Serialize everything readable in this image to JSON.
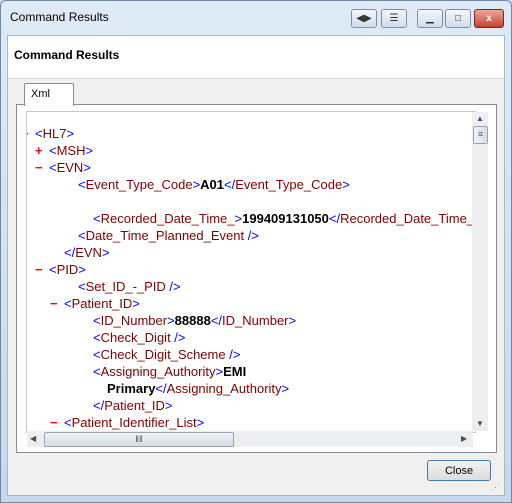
{
  "window": {
    "title": "Command Results",
    "close_glyph": "x"
  },
  "header": {
    "title": "Command Results"
  },
  "tabs": [
    {
      "label": "Xml"
    }
  ],
  "xml_lines": [
    {
      "toggle": "−",
      "parts": [
        {
          "k": "br",
          "t": "<"
        },
        {
          "k": "tg",
          "t": "HL7"
        },
        {
          "k": "br",
          "t": ">"
        }
      ]
    },
    {
      "toggle": "+",
      "parts": [
        {
          "k": "br",
          "t": "<"
        },
        {
          "k": "tg",
          "t": "MSH"
        },
        {
          "k": "br",
          "t": ">"
        }
      ]
    },
    {
      "toggle": "−",
      "parts": [
        {
          "k": "br",
          "t": "<"
        },
        {
          "k": "tg",
          "t": "EVN"
        },
        {
          "k": "br",
          "t": ">"
        }
      ]
    },
    {
      "toggle": "",
      "parts": [
        {
          "k": "br",
          "t": "<"
        },
        {
          "k": "tg",
          "t": "Event_Type_Code"
        },
        {
          "k": "br",
          "t": ">"
        },
        {
          "k": "val",
          "t": "A01"
        },
        {
          "k": "br",
          "t": "</"
        },
        {
          "k": "tg",
          "t": "Event_Type_Code"
        },
        {
          "k": "br",
          "t": ">"
        }
      ]
    },
    {
      "toggle": "",
      "parts": []
    },
    {
      "toggle": "",
      "parts": [
        {
          "k": "br",
          "t": "<"
        },
        {
          "k": "tg",
          "t": "Recorded_Date_Time_"
        },
        {
          "k": "br",
          "t": ">"
        },
        {
          "k": "val",
          "t": "199409131050"
        },
        {
          "k": "br",
          "t": "</"
        },
        {
          "k": "tg",
          "t": "Recorded_Date_Time_"
        },
        {
          "k": "br",
          "t": ">"
        }
      ]
    },
    {
      "toggle": "",
      "parts": [
        {
          "k": "br",
          "t": "<"
        },
        {
          "k": "tg",
          "t": "Date_Time_Planned_Event"
        },
        {
          "k": "br",
          "t": " />"
        }
      ]
    },
    {
      "toggle": "",
      "parts": [
        {
          "k": "br",
          "t": "</"
        },
        {
          "k": "tg",
          "t": "EVN"
        },
        {
          "k": "br",
          "t": ">"
        }
      ]
    },
    {
      "toggle": "−",
      "parts": [
        {
          "k": "br",
          "t": "<"
        },
        {
          "k": "tg",
          "t": "PID"
        },
        {
          "k": "br",
          "t": ">"
        }
      ]
    },
    {
      "toggle": "",
      "parts": [
        {
          "k": "br",
          "t": "<"
        },
        {
          "k": "tg",
          "t": "Set_ID_-_PID"
        },
        {
          "k": "br",
          "t": " />"
        }
      ]
    },
    {
      "toggle": "−",
      "parts": [
        {
          "k": "br",
          "t": "<"
        },
        {
          "k": "tg",
          "t": "Patient_ID"
        },
        {
          "k": "br",
          "t": ">"
        }
      ]
    },
    {
      "toggle": "",
      "parts": [
        {
          "k": "br",
          "t": "<"
        },
        {
          "k": "tg",
          "t": "ID_Number"
        },
        {
          "k": "br",
          "t": ">"
        },
        {
          "k": "val",
          "t": "88888"
        },
        {
          "k": "br",
          "t": "</"
        },
        {
          "k": "tg",
          "t": "ID_Number"
        },
        {
          "k": "br",
          "t": ">"
        }
      ]
    },
    {
      "toggle": "",
      "parts": [
        {
          "k": "br",
          "t": "<"
        },
        {
          "k": "tg",
          "t": "Check_Digit"
        },
        {
          "k": "br",
          "t": " />"
        }
      ]
    },
    {
      "toggle": "",
      "parts": [
        {
          "k": "br",
          "t": "<"
        },
        {
          "k": "tg",
          "t": "Check_Digit_Scheme"
        },
        {
          "k": "br",
          "t": " />"
        }
      ]
    },
    {
      "toggle": "",
      "parts": [
        {
          "k": "br",
          "t": "<"
        },
        {
          "k": "tg",
          "t": "Assigning_Authority"
        },
        {
          "k": "br",
          "t": ">"
        },
        {
          "k": "val",
          "t": "EMI"
        }
      ]
    },
    {
      "toggle": "",
      "parts": [
        {
          "k": "val",
          "t": "Primary"
        },
        {
          "k": "br",
          "t": "</"
        },
        {
          "k": "tg",
          "t": "Assigning_Authority"
        },
        {
          "k": "br",
          "t": ">"
        }
      ]
    },
    {
      "toggle": "",
      "parts": [
        {
          "k": "br",
          "t": "</"
        },
        {
          "k": "tg",
          "t": "Patient_ID"
        },
        {
          "k": "br",
          "t": ">"
        }
      ]
    },
    {
      "toggle": "−",
      "parts": [
        {
          "k": "br",
          "t": "<"
        },
        {
          "k": "tg",
          "t": "Patient_Identifier_List"
        },
        {
          "k": "br",
          "t": ">"
        }
      ]
    }
  ],
  "scroll_glyphs": {
    "up": "▲",
    "down": "▼",
    "left": "◀",
    "right": "▶",
    "grip": "≡"
  },
  "footer": {
    "close_label": "Close"
  },
  "resize_glyph": "⋰"
}
